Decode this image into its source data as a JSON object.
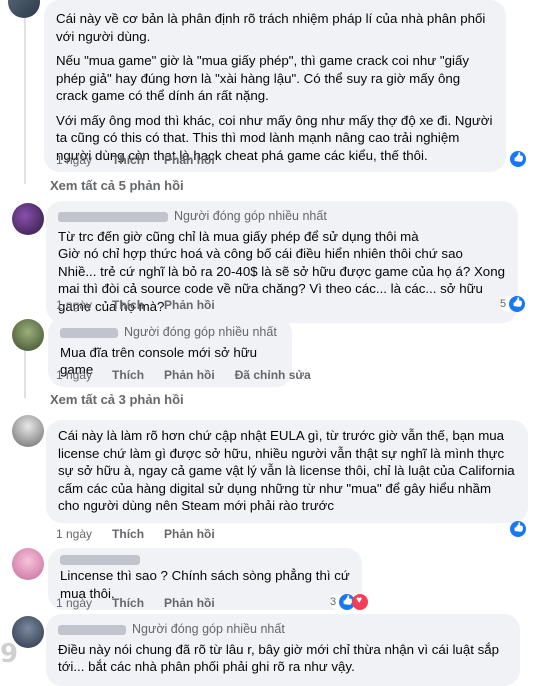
{
  "comments": [
    {
      "id": "c1",
      "paragraphs": [
        "Cái này về cơ bản là phân định rõ trách nhiệm pháp lí của nhà phân phối với người dùng.",
        "Nếu \"mua game\" giờ là \"mua giấy phép\", thì game crack coi như \"giấy phép giả\" hay đúng hơn là \"xài hàng lậu\". Có thể suy ra giờ mấy ông crack game có thể dính án rất nặng.",
        "Với mấy ông mod thì khác, coi như mấy ông như mấy thợ độ xe đi. Người ta cũng có this có that. This thì mod lành mạnh nâng cao trải nghiệm người dùng còn that là hack cheat phá game các kiểu, thế thôi."
      ],
      "time": "1 ngày",
      "like": "Thích",
      "reply": "Phản hồi",
      "reaction_count": ""
    },
    {
      "id": "c2",
      "badge": "Người đóng góp nhiều nhất",
      "paragraphs": [
        "Từ trc đến giờ cũng chỉ là mua giấy phép để sử dụng thôi mà\nGiờ nó chỉ hợp thức hoá và công bố cái điều hiển nhiên thôi chứ sao\nNhiề... trẻ cứ nghĩ là bỏ ra 20-40$ là sẽ sở hữu được game của họ á? Xong mai thì đòi cả source code về nữa chăng? Vì theo các... là các... sở hữu game của họ mà?"
      ],
      "time": "1 ngày",
      "like": "Thích",
      "reply": "Phản hồi",
      "reaction_count": "5"
    },
    {
      "id": "c3",
      "badge": "Người đóng góp nhiều nhất",
      "paragraphs": [
        "Mua đĩa trên console mới sở hữu game"
      ],
      "time": "1 ngày",
      "like": "Thích",
      "reply": "Phản hồi",
      "edited": "Đã chỉnh sửa"
    },
    {
      "id": "c4",
      "paragraphs": [
        "Cái này là làm rõ hơn chứ cập nhật EULA gì, từ trước giờ vẫn thế, bạn mua license chứ làm gì được sở hữu, nhiều người vẫn thật sự nghĩ là mình thực sự sở hữu à, ngay cả game vật lý vẫn là license thôi, chỉ là luật của California cấm các của hàng digital sử dụng những từ như \"mua\" để gây hiểu nhầm cho người dùng nên Steam mới phải rào trước"
      ],
      "time": "1 ngày",
      "like": "Thích",
      "reply": "Phản hồi"
    },
    {
      "id": "c5",
      "paragraphs": [
        "Lincense thì sao ? Chính sách sòng phẳng thì cứ mua thôi."
      ],
      "time": "1 ngày",
      "like": "Thích",
      "reply": "Phản hồi",
      "reaction_count": "3"
    },
    {
      "id": "c6",
      "badge": "Người đóng góp nhiều nhất",
      "paragraphs": [
        "Điều này nói chung đã rõ từ lâu r, bây giờ mới chỉ thừa nhận vì cái luật sắp tới... bắt các nhà phân phối phải ghi rõ ra như vậy."
      ]
    }
  ],
  "view_more": [
    "Xem tất cả 5 phản hồi",
    "Xem tất cả 3 phản hồi"
  ],
  "watermark": "9"
}
